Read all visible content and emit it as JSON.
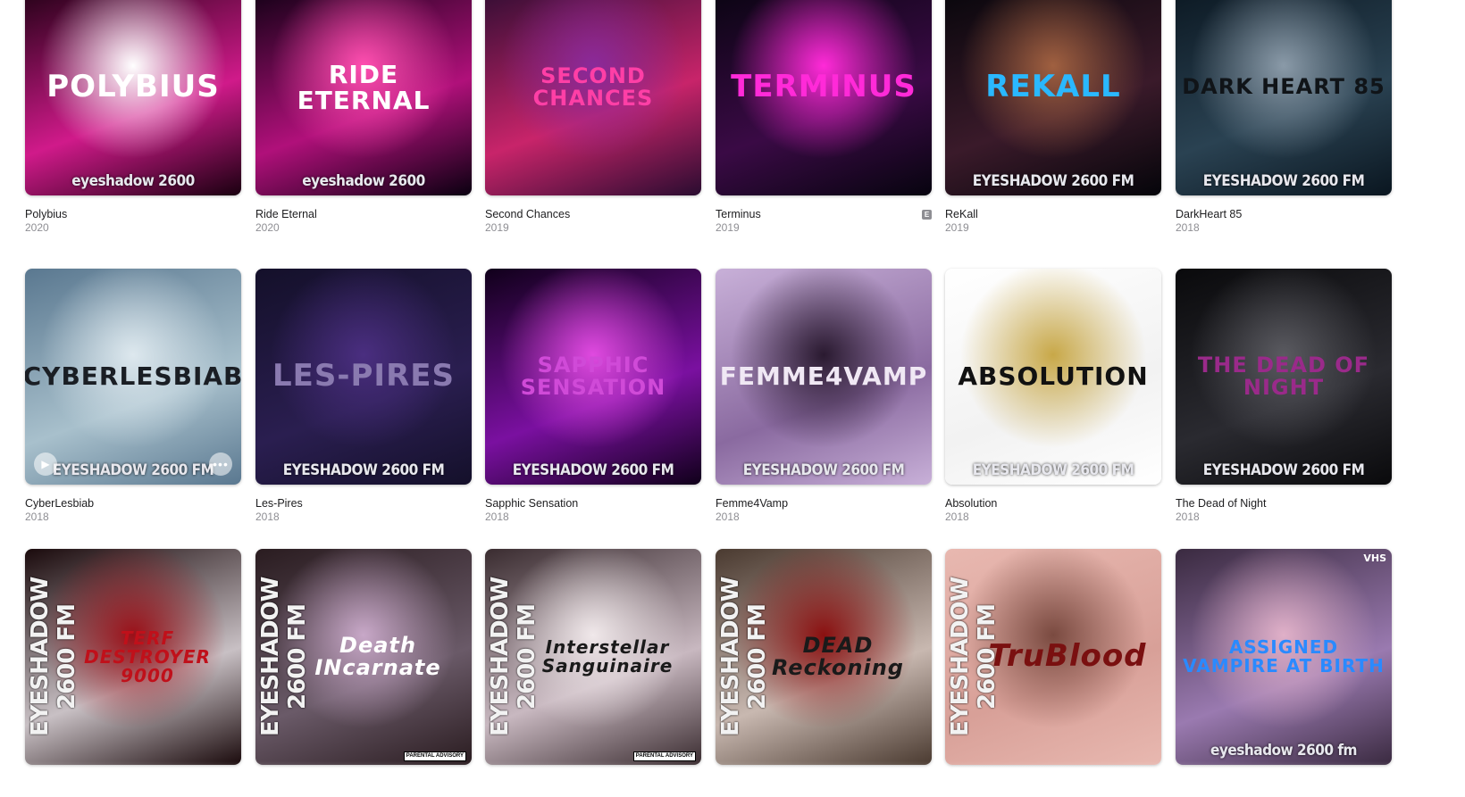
{
  "albums": [
    {
      "title": "Polybius",
      "year": "2020",
      "art_text": "POLYBIUS",
      "art_brand": "eyeshadow 2600",
      "colors": [
        "#1a0010",
        "#d01a8a",
        "#ffffff"
      ],
      "text_color": "#ffffff"
    },
    {
      "title": "Ride Eternal",
      "year": "2020",
      "art_text": "RIDE ETERNAL",
      "art_brand": "eyeshadow 2600",
      "colors": [
        "#0a0010",
        "#b0107a",
        "#ff4fb0"
      ],
      "text_color": "#ffffff"
    },
    {
      "title": "Second Chances",
      "year": "2019",
      "art_text": "SECOND CHANCES",
      "art_brand": "",
      "colors": [
        "#2a0c30",
        "#c8246a",
        "#8a2a9a"
      ],
      "text_color": "#ff3fa6"
    },
    {
      "title": "Terminus",
      "year": "2019",
      "art_text": "TERMINUS",
      "art_brand": "",
      "colors": [
        "#07040f",
        "#3a0a45",
        "#ff2ad8"
      ],
      "text_color": "#ff2ad8",
      "explicit": true
    },
    {
      "title": "ReKall",
      "year": "2019",
      "art_text": "REKALL",
      "art_brand": "EYESHADOW 2600 FM",
      "colors": [
        "#05050a",
        "#3a1a2a",
        "#a06040"
      ],
      "text_color": "#2ab8ff"
    },
    {
      "title": "DarkHeart 85",
      "year": "2018",
      "art_text": "DARK HEART 85",
      "art_brand": "EYESHADOW 2600 FM",
      "colors": [
        "#0a1620",
        "#2a4252",
        "#8a9aa8"
      ],
      "text_color": "#101418"
    },
    {
      "title": "CyberLesbiab",
      "year": "2018",
      "art_text": "CYBERLESBIAB",
      "art_brand": "EYESHADOW 2600 FM",
      "colors": [
        "#5a7890",
        "#a8c0cc",
        "#dde8ee"
      ],
      "text_color": "#1a1e24",
      "controls": true
    },
    {
      "title": "Les-Pires",
      "year": "2018",
      "art_text": "LES-PIRES",
      "art_brand": "EYESHADOW 2600 FM",
      "colors": [
        "#14102a",
        "#2a1e50",
        "#4a2e80"
      ],
      "text_color": "#8a7ab0"
    },
    {
      "title": "Sapphic Sensation",
      "year": "2018",
      "art_text": "SAPPHIC SENSATION",
      "art_brand": "EYESHADOW 2600 FM",
      "colors": [
        "#10001a",
        "#7a10a0",
        "#e04ae0"
      ],
      "text_color": "#d04ad8"
    },
    {
      "title": "Femme4Vamp",
      "year": "2018",
      "art_text": "FEMME4VAMP",
      "art_brand": "EYESHADOW 2600 FM",
      "colors": [
        "#c8b0d8",
        "#8a6aa0",
        "#2a1a30"
      ],
      "text_color": "#f0e8f4"
    },
    {
      "title": "Absolution",
      "year": "2018",
      "art_text": "ABSOLUTION",
      "art_brand": "EYESHADOW 2600 FM",
      "colors": [
        "#ffffff",
        "#f2f2f2",
        "#c8a848"
      ],
      "text_color": "#111111"
    },
    {
      "title": "The Dead of Night",
      "year": "2018",
      "art_text": "THE DEAD OF NIGHT",
      "art_brand": "EYESHADOW 2600 FM",
      "colors": [
        "#0a0a0c",
        "#2a2a30",
        "#5a5a60"
      ],
      "text_color": "#9a2a8a"
    },
    {
      "title": "",
      "year": "",
      "art_text": "TERF DESTROYER 9000",
      "art_brand": "EYESHADOW 2600 FM",
      "colors": [
        "#1a0a0c",
        "#c8c0c4",
        "#9a1018"
      ],
      "text_color": "#c0101a",
      "side": true
    },
    {
      "title": "",
      "year": "",
      "art_text": "Death INcarnate",
      "art_brand": "EYESHADOW 2600 FM",
      "colors": [
        "#2a1c20",
        "#6a5a68",
        "#c8a8c8"
      ],
      "text_color": "#ffffff",
      "side": true,
      "parental": true
    },
    {
      "title": "",
      "year": "",
      "art_text": "Interstellar Sanguinaire",
      "art_brand": "EYESHADOW 2600 FM",
      "colors": [
        "#3a2c30",
        "#c8b8c0",
        "#f0e8ea"
      ],
      "text_color": "#1a1a1a",
      "side": true,
      "parental": true
    },
    {
      "title": "",
      "year": "",
      "art_text": "DEAD Reckoning",
      "art_brand": "EYESHADOW 2600 FM",
      "colors": [
        "#4a3a30",
        "#c8b8b0",
        "#8a1010"
      ],
      "text_color": "#1a1a1a",
      "side": true
    },
    {
      "title": "",
      "year": "",
      "art_text": "TruBlood",
      "art_brand": "EYESHADOW 2600 FM",
      "colors": [
        "#e8b8b0",
        "#d8a098",
        "#7a4a40"
      ],
      "text_color": "#7a1010",
      "side": true
    },
    {
      "title": "",
      "year": "",
      "art_text": "ASSIGNED VAMPIRE AT BIRTH",
      "art_brand": "eyeshadow 2600 fm",
      "colors": [
        "#3a2a40",
        "#9a7ab0",
        "#e0b0c8"
      ],
      "text_color": "#2a8aff",
      "vhs": "VHS"
    }
  ],
  "labels": {
    "explicit": "E",
    "parental": "PARENTAL ADVISORY",
    "more": "•••",
    "play": "▶"
  }
}
